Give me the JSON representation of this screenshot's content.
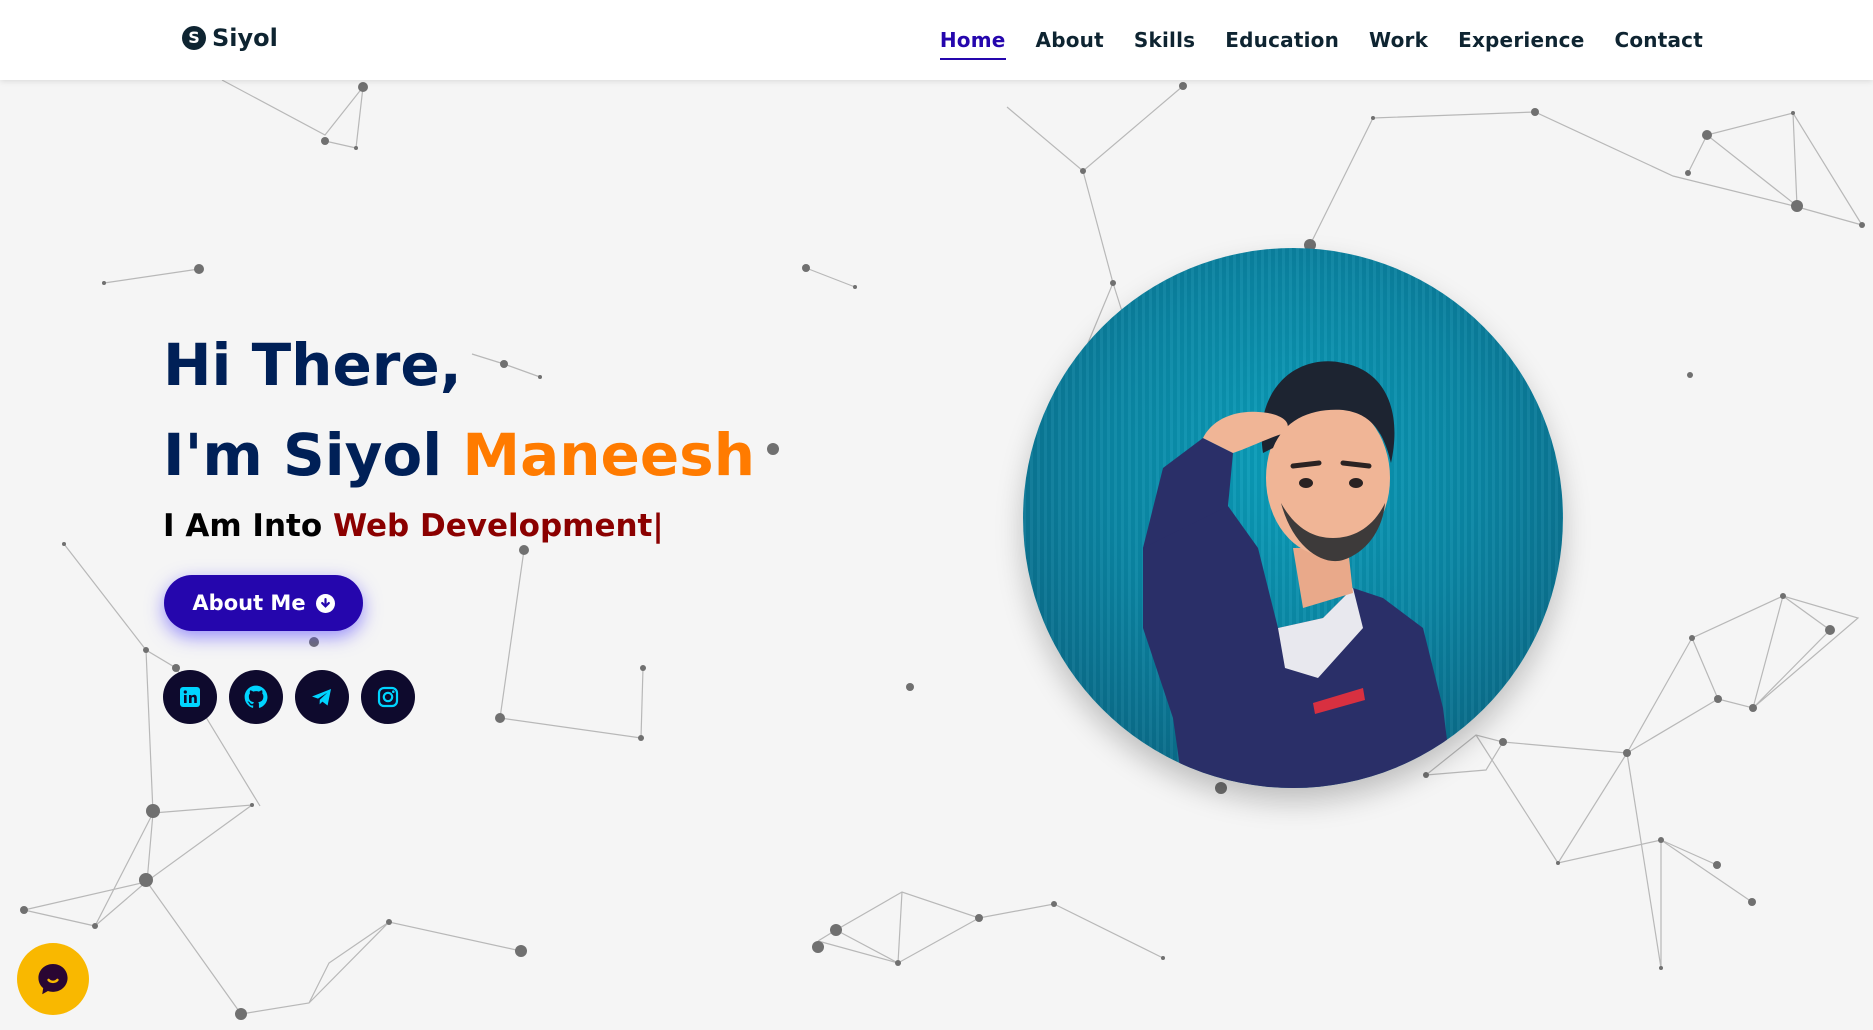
{
  "brand": {
    "logo_letter": "S",
    "name": "Siyol"
  },
  "nav": {
    "items": [
      "Home",
      "About",
      "Skills",
      "Education",
      "Work",
      "Experience",
      "Contact"
    ],
    "active": "Home"
  },
  "hero": {
    "greeting": "Hi There,",
    "intro_prefix": "I'm Siyol ",
    "intro_highlight": "Maneesh",
    "typed_prefix": "I Am Into ",
    "typed_role": "Web Development",
    "cursor": "|",
    "about_button": "About Me"
  },
  "socials": [
    "linkedin-icon",
    "github-icon",
    "telegram-icon",
    "instagram-icon"
  ],
  "colors": {
    "navy": "#002057",
    "accent_orange": "#ff7b00",
    "role_red": "#8b0000",
    "button_blue": "#2506ad",
    "social_icon": "#00d4ff",
    "chat_yellow": "#f9b800"
  },
  "chat_widget": {
    "icon": "chat-bubble-icon"
  }
}
